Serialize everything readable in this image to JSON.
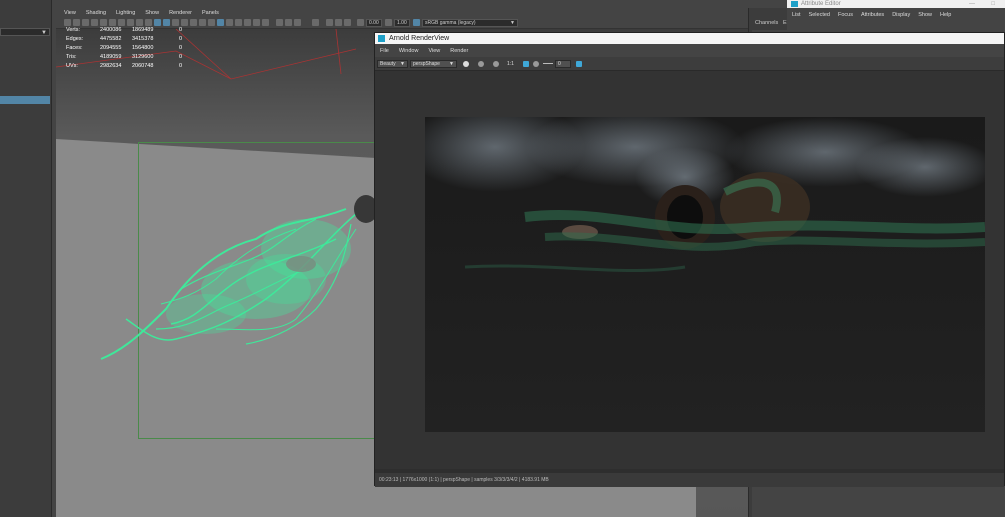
{
  "viewport": {
    "menu": [
      "View",
      "Shading",
      "Lighting",
      "Show",
      "Renderer",
      "Panels"
    ],
    "toolbar": {
      "exposure": "0.00",
      "gamma": "1.00",
      "colorspace": "sRGB gamma (legacy)"
    },
    "hud": {
      "rows": [
        {
          "label": "Verts:",
          "a": "2400086",
          "b": "1869489",
          "c": "0"
        },
        {
          "label": "Edges:",
          "a": "4475582",
          "b": "3415378",
          "c": "0"
        },
        {
          "label": "Faces:",
          "a": "2094555",
          "b": "1564800",
          "c": "0"
        },
        {
          "label": "Tris:",
          "a": "4189059",
          "b": "3129600",
          "c": "0"
        },
        {
          "label": "UVs:",
          "a": "2982634",
          "b": "2060748",
          "c": "0"
        }
      ]
    }
  },
  "channels": {
    "tab1": "Channels",
    "tab2": "E"
  },
  "attribute_editor": {
    "title": "Attribute Editor",
    "menu": [
      "List",
      "Selected",
      "Focus",
      "Attributes",
      "Display",
      "Show",
      "Help"
    ]
  },
  "renderview": {
    "title": "Arnold RenderView",
    "menu": [
      "File",
      "Window",
      "View",
      "Render"
    ],
    "aov": "Beauty",
    "camera": "perspShape",
    "ratio": "1:1",
    "exposure": "0",
    "status": "00:23:13 | 1776x1000 (1:1) | perspShape | samples 3/3/3/3/4/2 | 4183.91 MB"
  },
  "colors": {
    "accent": "#5285a6",
    "ivy_green": "#3fe89a",
    "arnold_blue": "#1ea0c8"
  }
}
